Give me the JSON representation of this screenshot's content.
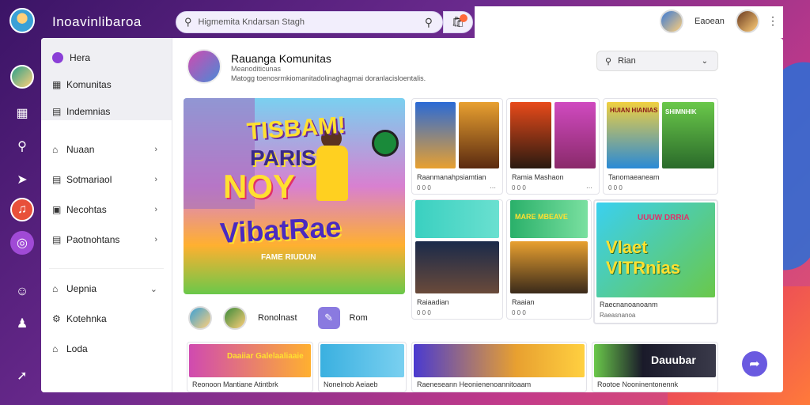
{
  "app": {
    "brand": "Inoavinlibaroa"
  },
  "search": {
    "placeholder": "Higmemita Kndarsan Stagh"
  },
  "header": {
    "user_name": "Eaoean"
  },
  "rail": {
    "icons": [
      "avatar-icon",
      "grid-icon",
      "search-icon",
      "megaphone-icon",
      "music-icon",
      "disc-icon",
      "smile-icon",
      "user-icon",
      "compass-icon"
    ]
  },
  "sidebar": {
    "items": [
      {
        "label": "Hera",
        "icon": "home-dot-icon"
      },
      {
        "label": "Komunitas",
        "icon": "table-icon"
      },
      {
        "label": "Indemnias",
        "icon": "table-icon"
      },
      {
        "label": "Nuaan",
        "icon": "home-icon"
      },
      {
        "label": "Sotmariaol",
        "icon": "list-icon"
      },
      {
        "label": "Necohtas",
        "icon": "image-icon"
      },
      {
        "label": "Paotnohtans",
        "icon": "list-icon"
      },
      {
        "label": "Uepnia",
        "icon": "home-icon"
      },
      {
        "label": "Kotehnka",
        "icon": "gear-icon"
      },
      {
        "label": "Loda",
        "icon": "home-icon"
      }
    ]
  },
  "page": {
    "title": "Rauanga Komunitas",
    "subtitle": "Meanoditicunas",
    "description": "Matogg toenosrmkiomanitadolinaghagmai doranlacisloentalis.",
    "filter_label": "Rian"
  },
  "hero": {
    "line1": "TISBAM!",
    "line2": "PARIS",
    "line3": "NOY",
    "line4": "VibatRae",
    "tagline": "FAME RIUDUN"
  },
  "avatar_row": {
    "label1": "Ronolnast",
    "label2": "Rom"
  },
  "cards": [
    {
      "caption": "Raanmanahpsiamtian",
      "meta": "0 0 0"
    },
    {
      "caption": "Ramia Mashaon",
      "meta": "0 0 0"
    },
    {
      "caption": "Tanomaeaneam",
      "meta": "0 0 0"
    },
    {
      "caption": "Raiaadian",
      "meta": "0 0 0"
    },
    {
      "caption": "Raaian",
      "meta": "0 0 0"
    },
    {
      "caption": "Raecnanoanoanm",
      "meta": "Raeasnanoa"
    }
  ],
  "bottom_cards": [
    {
      "caption": "Reonoon Mantiane Atintbrk"
    },
    {
      "caption": "Nonelnob Aeiaeb"
    },
    {
      "caption": "Raeneseann Heonienenoannitoaam"
    },
    {
      "caption": "Rootoe Nooninentonennk"
    }
  ],
  "overlay_texts": {
    "card3_title": "HUIAN HIANIAS",
    "card3_sub": "SHIMNHIK",
    "card5_title": "Vlaet VlTRnias",
    "card5_sub": "UUUW DRRIA",
    "card6_title": "Dauubar",
    "bottom1_title": "Daaiiar Galelaaliaaie",
    "card2_band": "MARE MBEAVE"
  },
  "colors": {
    "accent": "#6a5ae0",
    "brand_purple": "#8a3fd6",
    "bg": "#3b1466"
  }
}
